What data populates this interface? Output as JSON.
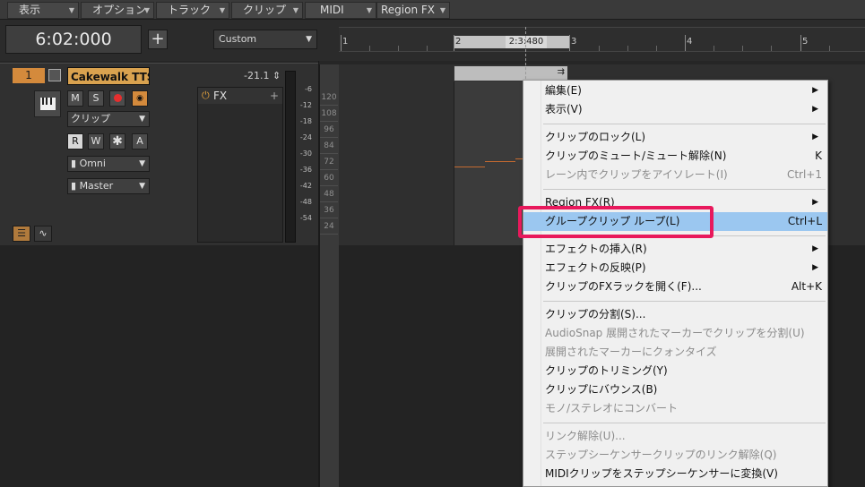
{
  "menubar": {
    "items": [
      "表示",
      "オプション",
      "トラック",
      "クリップ",
      "MIDI",
      "Region FX"
    ]
  },
  "transport": {
    "time": "6:02:000",
    "add_label": "+",
    "preset": "Custom"
  },
  "ruler": {
    "markers": [
      "1",
      "2",
      "2:3:480",
      "3",
      "4",
      "5"
    ]
  },
  "track": {
    "number": "1",
    "name": "Cakewalk TTS-",
    "volume": "-21.1",
    "buttons": {
      "mute": "M",
      "solo": "S",
      "read": "R",
      "write": "W",
      "star": "✱",
      "archive": "A"
    },
    "clip_dropdown": "クリップ",
    "input": "Omni",
    "output": "Master",
    "fx_label": "FX",
    "meter_scale": [
      "-6",
      "-12",
      "-18",
      "-24",
      "-30",
      "-36",
      "-42",
      "-48",
      "-54"
    ]
  },
  "piano": {
    "labels": [
      "120",
      "108",
      "96",
      "84",
      "72",
      "60",
      "48",
      "36",
      "24"
    ]
  },
  "context_menu": {
    "items": [
      {
        "label": "編集(E)",
        "submenu": true
      },
      {
        "label": "表示(V)",
        "submenu": true
      },
      {
        "separator": true
      },
      {
        "label": "クリップのロック(L)",
        "submenu": true
      },
      {
        "label": "クリップのミュート/ミュート解除(N)",
        "shortcut": "K"
      },
      {
        "label": "レーン内でクリップをアイソレート(I)",
        "shortcut": "Ctrl+1",
        "disabled": true
      },
      {
        "separator": true
      },
      {
        "label": "Region FX(R)",
        "submenu": true
      },
      {
        "label": "グループクリップ ループ(L)",
        "shortcut": "Ctrl+L",
        "highlighted": true
      },
      {
        "separator": true
      },
      {
        "label": "エフェクトの挿入(R)",
        "submenu": true
      },
      {
        "label": "エフェクトの反映(P)",
        "submenu": true
      },
      {
        "label": "クリップのFXラックを開く(F)...",
        "shortcut": "Alt+K"
      },
      {
        "separator": true
      },
      {
        "label": "クリップの分割(S)..."
      },
      {
        "label": "AudioSnap 展開されたマーカーでクリップを分割(U)",
        "disabled": true
      },
      {
        "label": "展開されたマーカーにクォンタイズ",
        "disabled": true
      },
      {
        "label": "クリップのトリミング(Y)"
      },
      {
        "label": "クリップにバウンス(B)"
      },
      {
        "label": "モノ/ステレオにコンバート",
        "disabled": true
      },
      {
        "separator": true
      },
      {
        "label": "リンク解除(U)...",
        "disabled": true
      },
      {
        "label": "ステップシーケンサークリップのリンク解除(Q)",
        "disabled": true
      },
      {
        "label": "MIDIクリップをステップシーケンサーに変換(V)"
      }
    ]
  },
  "colors": {
    "accent_orange": "#d48a3c",
    "highlight_box": "#e8195c",
    "menu_highlight": "#9bc7f0"
  }
}
